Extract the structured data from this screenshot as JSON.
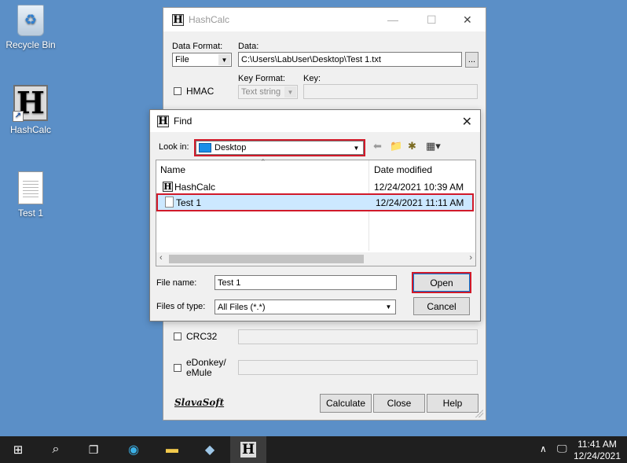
{
  "desktop": {
    "icons": [
      {
        "label": "Recycle Bin"
      },
      {
        "label": "HashCalc"
      },
      {
        "label": "Test 1"
      }
    ]
  },
  "hashcalc": {
    "title": "HashCalc",
    "data_format_label": "Data Format:",
    "data_format_value": "File",
    "data_label": "Data:",
    "data_value": "C:\\Users\\LabUser\\Desktop\\Test 1.txt",
    "browse_label": "...",
    "hmac_label": "HMAC",
    "key_format_label": "Key Format:",
    "key_format_value": "Text string",
    "key_label": "Key:",
    "crc32_label": "CRC32",
    "edonkey_label_line1": "eDonkey/",
    "edonkey_label_line2": "eMule",
    "logo": "SlavaSoft",
    "calculate_label": "Calculate",
    "close_label": "Close",
    "help_label": "Help"
  },
  "find": {
    "title": "Find",
    "look_in_label": "Look in:",
    "look_in_value": "Desktop",
    "columns": {
      "name": "Name",
      "date": "Date modified"
    },
    "rows": [
      {
        "name": "HashCalc",
        "date": "12/24/2021 10:39 AM"
      },
      {
        "name": "Test 1",
        "date": "12/24/2021 11:11 AM"
      }
    ],
    "file_name_label": "File name:",
    "file_name_value": "Test 1",
    "files_of_type_label": "Files of type:",
    "files_of_type_value": "All Files (*.*)",
    "open_label": "Open",
    "cancel_label": "Cancel"
  },
  "taskbar": {
    "time": "11:41 AM",
    "date": "12/24/2021"
  },
  "colors": {
    "desktop_bg": "#5b8fc7",
    "highlight_red": "#d11a2a",
    "selection": "#cce8ff",
    "taskbar": "#1f1f1f"
  }
}
